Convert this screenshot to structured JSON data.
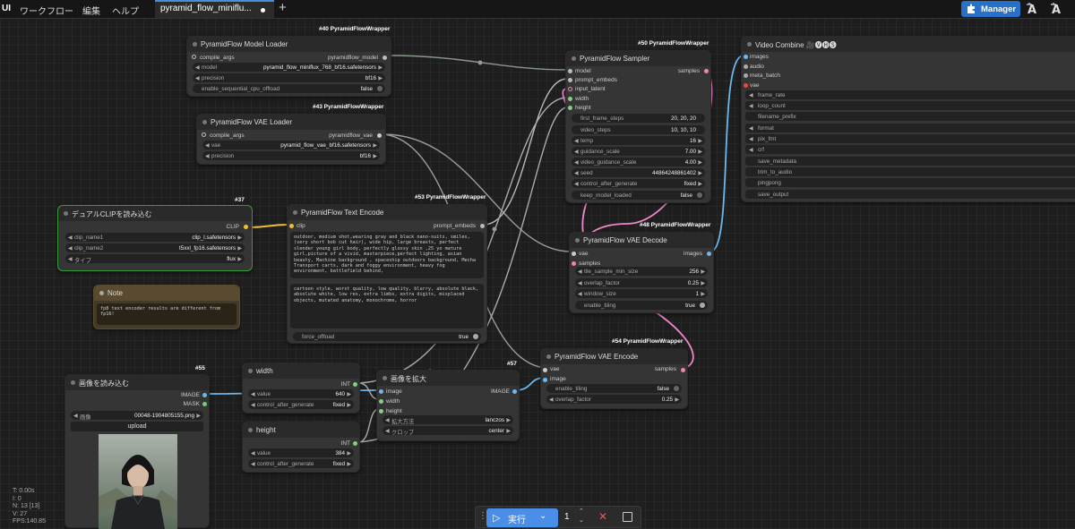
{
  "topbar": {
    "logo": "UI",
    "menu": [
      "ワークフロー",
      "編集",
      "ヘルプ"
    ],
    "tab_title": "pyramid_flow_miniflu...",
    "manager_label": "Manager",
    "accent": "#2870c8"
  },
  "nodes": {
    "model_loader": {
      "badge": "#40 PyramidFlowWrapper",
      "title": "PyramidFlow Model Loader",
      "input": "compile_args",
      "output": "pyramidflow_model",
      "widgets": [
        {
          "label": "model",
          "value": "pyramid_flow_miniflux_768_bf16.safetensors"
        },
        {
          "label": "precision",
          "value": "bf16"
        },
        {
          "label": "enable_sequential_cpu_offload",
          "value": "false"
        }
      ]
    },
    "vae_loader": {
      "badge": "#43 PyramidFlowWrapper",
      "title": "PyramidFlow VAE Loader",
      "input": "compile_args",
      "output": "pyramidflow_vae",
      "widgets": [
        {
          "label": "vae",
          "value": "pyramid_flow_vae_bf16.safetensors"
        },
        {
          "label": "precision",
          "value": "bf16"
        }
      ]
    },
    "sampler": {
      "badge": "#50 PyramidFlowWrapper",
      "title": "PyramidFlow Sampler",
      "inputs": [
        "model",
        "prompt_embeds",
        "input_latent",
        "width",
        "height"
      ],
      "output": "samples",
      "widgets": [
        {
          "label": "first_frame_steps",
          "value": "20, 20, 20"
        },
        {
          "label": "video_steps",
          "value": "10, 10, 10"
        },
        {
          "label": "temp",
          "value": "16"
        },
        {
          "label": "guidance_scale",
          "value": "7.00"
        },
        {
          "label": "video_guidance_scale",
          "value": "4.00"
        },
        {
          "label": "seed",
          "value": "44864248861402"
        },
        {
          "label": "control_after_generate",
          "value": "fixed"
        },
        {
          "label": "keep_model_loaded",
          "value": "false"
        }
      ]
    },
    "video_combine": {
      "title": "Video Combine 🎥🅥🅗🅢",
      "inputs": [
        "images",
        "audio",
        "meta_batch",
        "vae"
      ],
      "widgets": [
        "frame_rate",
        "loop_count",
        "filename_prefix",
        "format",
        "pix_fmt",
        "crf",
        "save_metadata",
        "trim_to_audio",
        "pingpong",
        "save_output"
      ]
    },
    "clip_loader": {
      "badge": "#37",
      "title": "デュアルCLIPを読み込む",
      "output": "CLIP",
      "widgets": [
        {
          "label": "clip_name1",
          "value": "clip_l.safetensors"
        },
        {
          "label": "clip_name2",
          "value": "t5xxl_fp16.safetensors"
        },
        {
          "label": "タイプ",
          "value": "flux"
        }
      ]
    },
    "text_encode": {
      "badge": "#53 PyramidFlowWrapper",
      "title": "PyramidFlow Text Encode",
      "input": "clip",
      "output": "prompt_embeds",
      "positive": "outdoor, medium shot,wearing gray and black nano-suits, smiles, (very short bob cut hair), wide hip, large breasts, perfect slender young girl body, perfectly glossy skin ,25 yo mature girl,picture of a vivid, masterpiece,perfect lighting, asian beauty, Machine background , spaceship outdoors background, Mecha Transport carts, dark and foggy environment, heavy fog environment, battlefield behind,",
      "negative": "cartoon style, worst quality, low quality, blurry, absolute black, absolute white, low res, extra limbs, extra digits, misplaced objects, mutated anatomy, monochrome, horror",
      "widgets": [
        {
          "label": "force_offload",
          "value": "true"
        }
      ]
    },
    "note": {
      "title": "Note",
      "text": "fp8 text encoder results are different from fp16!"
    },
    "vae_decode": {
      "badge": "#48 PyramidFlowWrapper",
      "title": "PyramidFlow VAE Decode",
      "inputs": [
        "vae",
        "samples"
      ],
      "output": "images",
      "widgets": [
        {
          "label": "tile_sample_min_size",
          "value": "256"
        },
        {
          "label": "overlap_factor",
          "value": "0.25"
        },
        {
          "label": "window_size",
          "value": "1"
        },
        {
          "label": "enable_tiling",
          "value": "true"
        }
      ]
    },
    "vae_encode": {
      "badge": "#54 PyramidFlowWrapper",
      "title": "PyramidFlow VAE Encode",
      "inputs": [
        "vae",
        "image"
      ],
      "output": "samples",
      "widgets": [
        {
          "label": "enable_tiling",
          "value": "false"
        },
        {
          "label": "overlap_factor",
          "value": "0.25"
        }
      ]
    },
    "load_image": {
      "badge": "#55",
      "title": "画像を読み込む",
      "outputs": [
        "IMAGE",
        "MASK"
      ],
      "widgets": [
        {
          "label": "画像",
          "value": "00048-1904805155.png"
        }
      ],
      "upload_label": "upload"
    },
    "width": {
      "title": "width",
      "output": "INT",
      "widgets": [
        {
          "label": "value",
          "value": "640"
        },
        {
          "label": "control_after_generate",
          "value": "fixed"
        }
      ]
    },
    "height": {
      "title": "height",
      "output": "INT",
      "widgets": [
        {
          "label": "value",
          "value": "384"
        },
        {
          "label": "control_after_generate",
          "value": "fixed"
        }
      ]
    },
    "upscale": {
      "badge": "#57",
      "title": "画像を拡大",
      "inputs": [
        "image",
        "width",
        "height"
      ],
      "output": "IMAGE",
      "widgets": [
        {
          "label": "拡大方法",
          "value": "lanczos"
        },
        {
          "label": "クロップ",
          "value": "center"
        }
      ]
    }
  },
  "stats": [
    "T: 0.00s",
    "I: 0",
    "N: 13 [13]",
    "V: 27",
    "FPS:140.85"
  ],
  "runbar": {
    "run_label": "実行",
    "count": "1"
  }
}
